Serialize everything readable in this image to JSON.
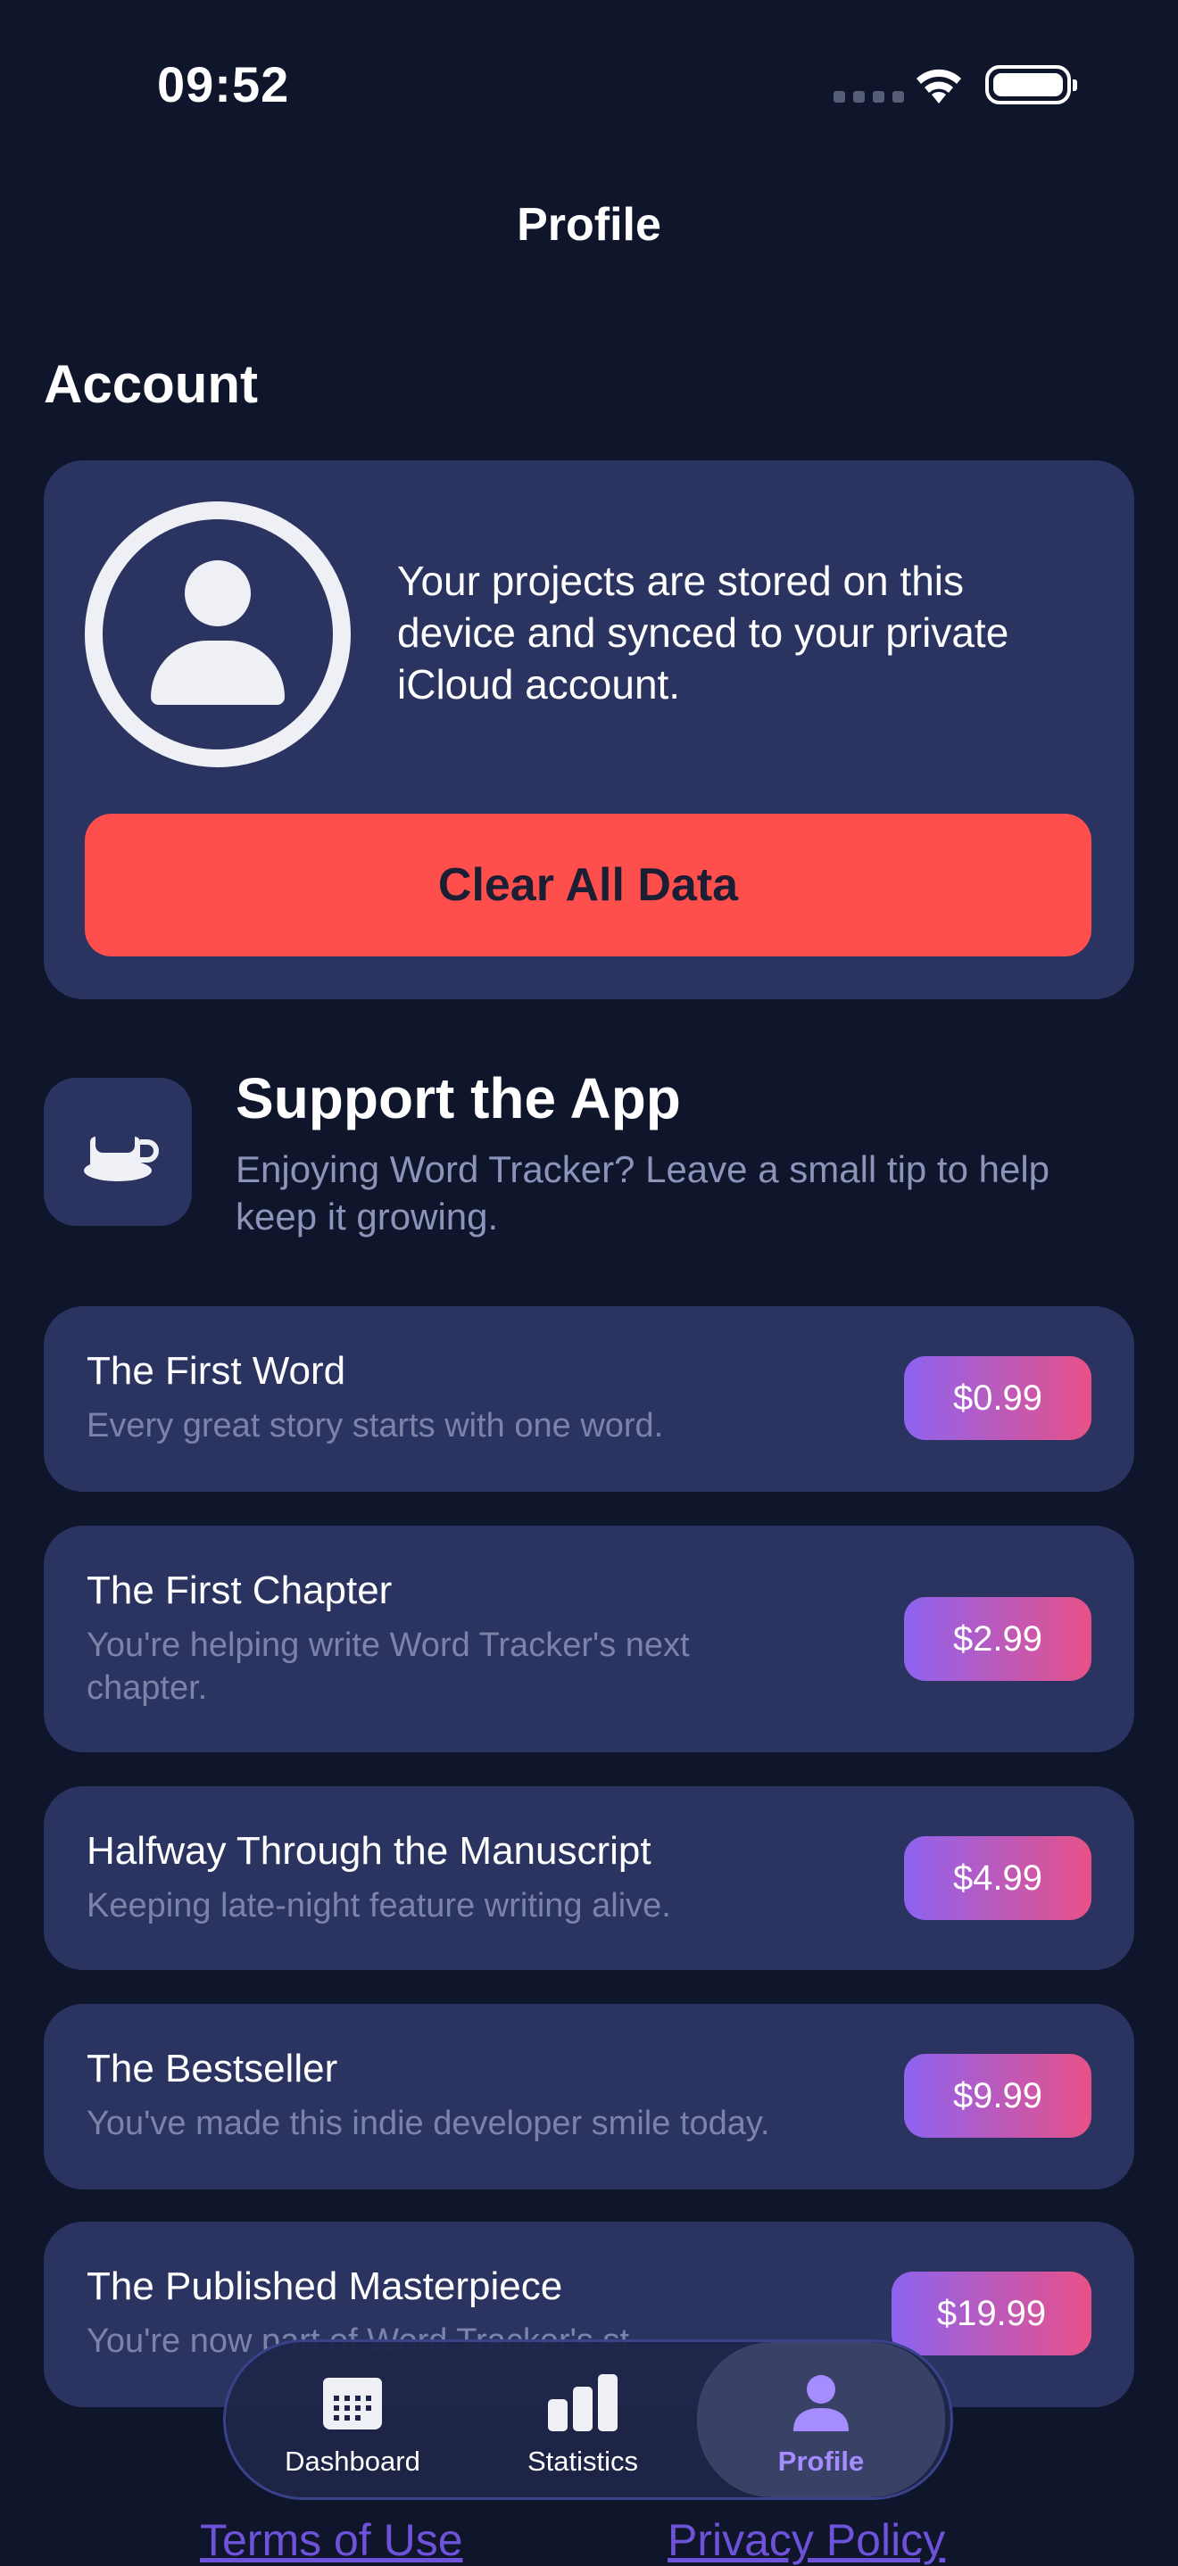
{
  "status_bar": {
    "time": "09:52"
  },
  "nav": {
    "title": "Profile"
  },
  "account": {
    "section_title": "Account",
    "description": "Your projects are stored on this device and synced to your private iCloud account.",
    "clear_button": "Clear All Data"
  },
  "support": {
    "title": "Support the App",
    "subtitle": "Enjoying Word Tracker? Leave a small tip to help keep it growing.",
    "icon": "coffee-cup-icon"
  },
  "tips": [
    {
      "title": "The First Word",
      "description": "Every great story starts with one word.",
      "price": "$0.99"
    },
    {
      "title": "The First Chapter",
      "description": "You're helping write Word Tracker's next chapter.",
      "price": "$2.99"
    },
    {
      "title": "Halfway Through the Manuscript",
      "description": "Keeping late-night feature writing alive.",
      "price": "$4.99"
    },
    {
      "title": "The Bestseller",
      "description": "You've made this indie developer smile today.",
      "price": "$9.99"
    },
    {
      "title": "The Published Masterpiece",
      "description": "You're now part of Word Tracker's st",
      "price": "$19.99"
    }
  ],
  "tabbar": {
    "items": [
      {
        "label": "Dashboard",
        "icon": "calendar-icon",
        "active": false
      },
      {
        "label": "Statistics",
        "icon": "bar-chart-icon",
        "active": false
      },
      {
        "label": "Profile",
        "icon": "person-icon",
        "active": true
      }
    ]
  },
  "footer": {
    "terms": "Terms of Use",
    "privacy": "Privacy Policy"
  },
  "colors": {
    "background": "#0f152b",
    "card": "#2b3461",
    "danger": "#ff4f4d",
    "accent": "#a58cff",
    "price_gradient_start": "#8d63f0",
    "price_gradient_end": "#e85188"
  }
}
